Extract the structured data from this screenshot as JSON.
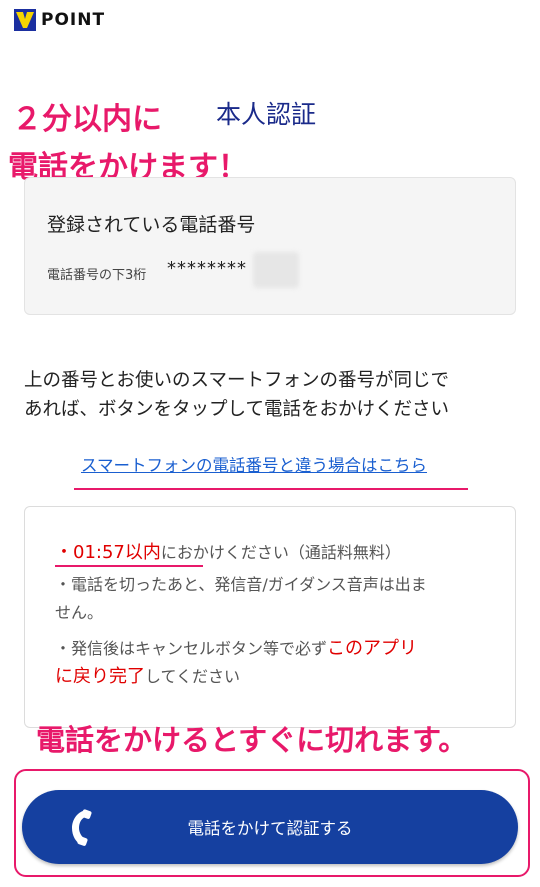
{
  "header": {
    "logo_text": "POINT",
    "logo_icon": "v-logo-icon"
  },
  "page": {
    "title": "本人認証"
  },
  "annotations": {
    "line1": "２分以内に",
    "line2": "電話をかけます！",
    "line3": "電話をかけるとすぐに切れます。"
  },
  "phone_card": {
    "label": "登録されている電話番号",
    "sub_label": "電話番号の下3桁",
    "masked_number": "********"
  },
  "description": {
    "line1": "上の番号とお使いのスマートフォンの番号が同じで",
    "line2": "あれば、ボタンをタップして電話をおかけください"
  },
  "link": {
    "text": "スマートフォンの電話番号と違う場合はこちら"
  },
  "info": {
    "bullet": "・",
    "time_limit": "01:57以内",
    "line1_rest": "におかけください（通話料無料）",
    "line2": "・電話を切ったあと、発信音/ガイダンス音声は出ま",
    "line2b": "せん。",
    "line3_pre": "・発信後はキャンセルボタン等で必ず",
    "line3_red1": "このアプリ",
    "line3_red2": "に戻り完了",
    "line3_post": "してください"
  },
  "cta": {
    "label": "電話をかけて認証する",
    "icon": "phone-icon"
  },
  "colors": {
    "accent_pink": "#e8196a",
    "brand_blue": "#1540a0",
    "title_navy": "#1a2a8a",
    "warning_red": "#e00000",
    "link_blue": "#1a5fd0"
  }
}
